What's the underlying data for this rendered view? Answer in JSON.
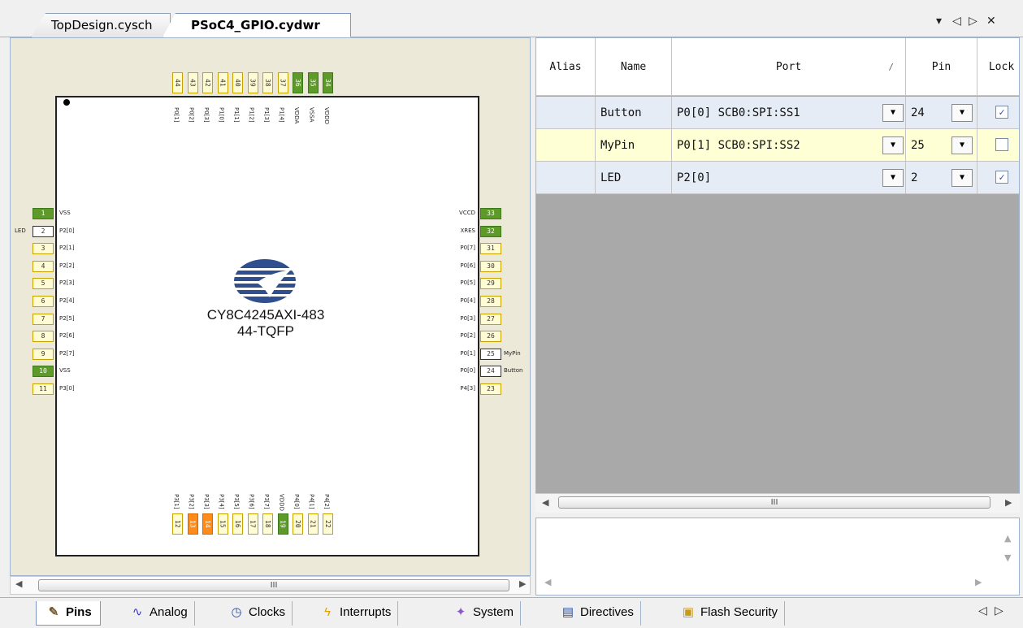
{
  "doc_tabs": [
    "TopDesign.cysch",
    "PSoC4_GPIO.cydwr"
  ],
  "tab_controls": {
    "dropdown": "▾",
    "prev": "◁",
    "next": "▷",
    "close": "✕"
  },
  "chip": {
    "part": "CY8C4245AXI-483",
    "package": "44-TQFP"
  },
  "pins_top": [
    {
      "num": "44",
      "name": "P0[1]"
    },
    {
      "num": "43",
      "name": "P0[2]"
    },
    {
      "num": "42",
      "name": "P0[3]"
    },
    {
      "num": "41",
      "name": "P1[0]"
    },
    {
      "num": "40",
      "name": "P1[1]"
    },
    {
      "num": "39",
      "name": "P1[2]"
    },
    {
      "num": "38",
      "name": "P1[3]"
    },
    {
      "num": "37",
      "name": "P1[4]"
    },
    {
      "num": "36",
      "name": "VDDA"
    },
    {
      "num": "35",
      "name": "VSSA"
    },
    {
      "num": "34",
      "name": "VDDD"
    }
  ],
  "pins_left": [
    {
      "num": "1",
      "name": "VSS",
      "ext": ""
    },
    {
      "num": "2",
      "name": "P2[0]",
      "ext": "LED"
    },
    {
      "num": "3",
      "name": "P2[1]",
      "ext": ""
    },
    {
      "num": "4",
      "name": "P2[2]",
      "ext": ""
    },
    {
      "num": "5",
      "name": "P2[3]",
      "ext": ""
    },
    {
      "num": "6",
      "name": "P2[4]",
      "ext": ""
    },
    {
      "num": "7",
      "name": "P2[5]",
      "ext": ""
    },
    {
      "num": "8",
      "name": "P2[6]",
      "ext": ""
    },
    {
      "num": "9",
      "name": "P2[7]",
      "ext": ""
    },
    {
      "num": "10",
      "name": "VSS",
      "ext": ""
    },
    {
      "num": "11",
      "name": "P3[0]",
      "ext": ""
    }
  ],
  "pins_right": [
    {
      "num": "33",
      "name": "VCCD",
      "ext": ""
    },
    {
      "num": "32",
      "name": "XRES",
      "ext": ""
    },
    {
      "num": "31",
      "name": "P0[7]",
      "ext": ""
    },
    {
      "num": "30",
      "name": "P0[6]",
      "ext": ""
    },
    {
      "num": "29",
      "name": "P0[5]",
      "ext": ""
    },
    {
      "num": "28",
      "name": "P0[4]",
      "ext": ""
    },
    {
      "num": "27",
      "name": "P0[3]",
      "ext": ""
    },
    {
      "num": "26",
      "name": "P0[2]",
      "ext": ""
    },
    {
      "num": "25",
      "name": "P0[1]",
      "ext": "MyPin"
    },
    {
      "num": "24",
      "name": "P0[0]",
      "ext": "Button"
    },
    {
      "num": "23",
      "name": "P4[3]",
      "ext": ""
    }
  ],
  "pins_bottom": [
    {
      "num": "12",
      "name": "P3[1]"
    },
    {
      "num": "13",
      "name": "P3[2]"
    },
    {
      "num": "14",
      "name": "P3[3]"
    },
    {
      "num": "15",
      "name": "P3[4]"
    },
    {
      "num": "16",
      "name": "P3[5]"
    },
    {
      "num": "17",
      "name": "P3[6]"
    },
    {
      "num": "18",
      "name": "P3[7]"
    },
    {
      "num": "19",
      "name": "VDDD"
    },
    {
      "num": "20",
      "name": "P4[0]"
    },
    {
      "num": "21",
      "name": "P4[1]"
    },
    {
      "num": "22",
      "name": "P4[2]"
    }
  ],
  "grid": {
    "headers": {
      "alias": "Alias",
      "name": "Name",
      "port": "Port",
      "sort": "/",
      "pin": "Pin",
      "lock": "Lock"
    },
    "rows": [
      {
        "alias": "",
        "name": "Button",
        "port": "P0[0] SCB0:SPI:SS1",
        "pin": "24",
        "lock": true
      },
      {
        "alias": "",
        "name": "MyPin",
        "port": "P0[1] SCB0:SPI:SS2",
        "pin": "25",
        "lock": false
      },
      {
        "alias": "",
        "name": "LED",
        "port": "P2[0]",
        "pin": "2",
        "lock": true
      }
    ],
    "hscroll_grip": "III"
  },
  "left_hscroll_grip": "III",
  "bottom_tabs": [
    {
      "label": "Pins",
      "icon": "pins-icon"
    },
    {
      "label": "Analog",
      "icon": "analog-icon"
    },
    {
      "label": "Clocks",
      "icon": "clock-icon"
    },
    {
      "label": "Interrupts",
      "icon": "interrupt-icon"
    },
    {
      "label": "System",
      "icon": "system-icon"
    },
    {
      "label": "Directives",
      "icon": "directives-icon"
    },
    {
      "label": "Flash Security",
      "icon": "lock-icon"
    }
  ],
  "colors": {
    "accent": "#5e9a2a",
    "debug_pin": "#ff8c1a",
    "selected_row": "#ffffd6",
    "pin_func": "#6a54c8"
  }
}
